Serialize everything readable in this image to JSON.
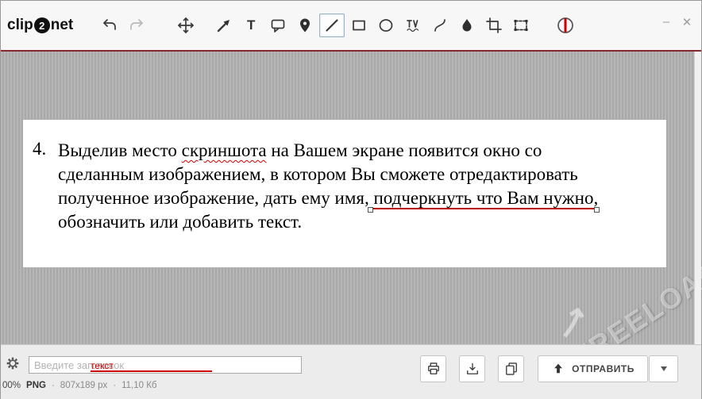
{
  "window": {
    "minimize": "–",
    "close": "✕"
  },
  "logo": {
    "part1": "clip",
    "part2": "2",
    "part3": "net"
  },
  "toolbar": {
    "selected_tool": "pen",
    "tools": [
      "undo",
      "redo",
      "move",
      "arrow",
      "text",
      "callout",
      "marker",
      "pen",
      "rectangle",
      "ellipse",
      "censor",
      "curve",
      "blur",
      "crop",
      "region",
      "color-indicator"
    ],
    "text_tool_glyph": "T"
  },
  "note": {
    "number": "4.",
    "lines": [
      {
        "s0": "Выделив место ",
        "s1": "скриншота",
        "s2": " на Вашем экране появится окно со"
      },
      {
        "s0": "сделанным изображением, в котором Вы сможете отредактировать"
      },
      {
        "s0": "полученное изображение, дать ему имя, ",
        "s1": "подчеркнуть что Вам нужно",
        "s2": ","
      },
      {
        "s0": "обозначить или добавить текст."
      }
    ]
  },
  "bottom": {
    "title_placeholder": "Введите заголовок",
    "annotation": "текст",
    "status": {
      "zoom": "00%",
      "format": "PNG",
      "dimensions": "807x189 px",
      "size": "11,10 Кб",
      "sep": "·"
    },
    "send": {
      "label": "ОТПРАВИТЬ"
    }
  },
  "watermark": {
    "text": "FREELOAD"
  },
  "colors": {
    "accent_red": "#cc0000",
    "canvas_stripe": "#aeaeae",
    "toolbar_bg": "#f7f7f7"
  }
}
